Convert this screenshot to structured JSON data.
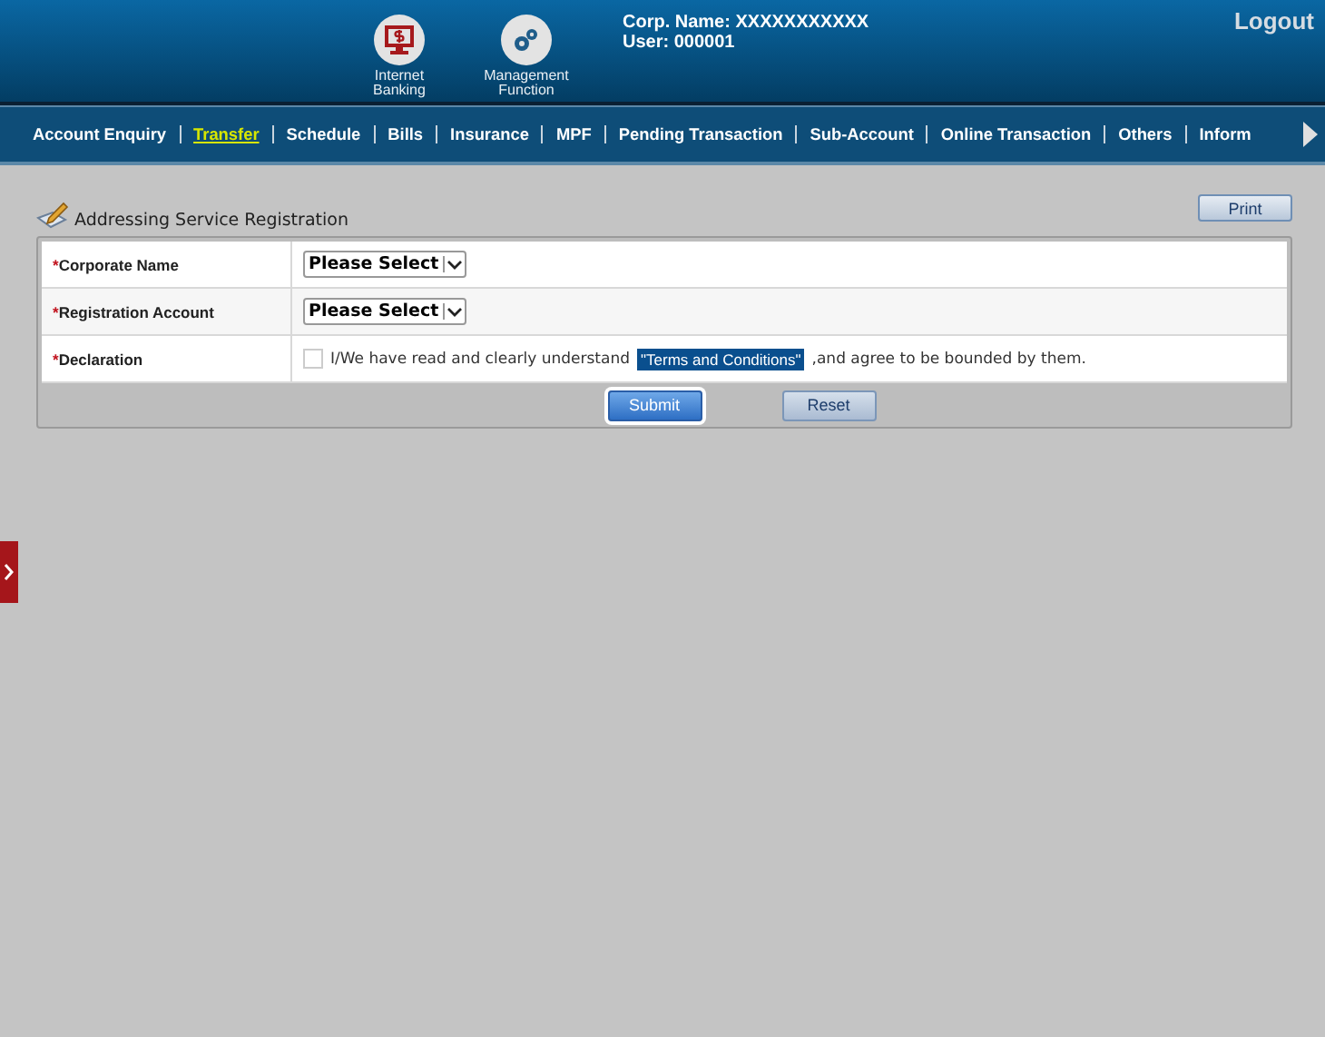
{
  "header": {
    "shortcuts": [
      {
        "kind": "banking",
        "label": "Internet Banking"
      },
      {
        "kind": "management",
        "label": "Management Function"
      }
    ],
    "corp_label": "Corp. Name:",
    "corp_value": "XXXXXXXXXXX",
    "user_label": "User:",
    "user_value": "000001",
    "logout": "Logout"
  },
  "nav": [
    {
      "label": "Account Enquiry",
      "selected": false
    },
    {
      "label": "Transfer",
      "selected": true
    },
    {
      "label": "Schedule",
      "selected": false
    },
    {
      "label": "Bills",
      "selected": false
    },
    {
      "label": "Insurance",
      "selected": false
    },
    {
      "label": "MPF",
      "selected": false
    },
    {
      "label": "Pending Transaction",
      "selected": false
    },
    {
      "label": "Sub-Account",
      "selected": false
    },
    {
      "label": "Online Transaction",
      "selected": false
    },
    {
      "label": "Others",
      "selected": false
    },
    {
      "label": "Inform",
      "selected": false
    }
  ],
  "page": {
    "title": "Addressing Service Registration",
    "print": "Print"
  },
  "form": {
    "rows": [
      {
        "kind": "select",
        "required_mark": "*",
        "label": "Corporate Name",
        "value": "Please Select"
      },
      {
        "kind": "select",
        "required_mark": "*",
        "label": "Registration Account",
        "value": "Please Select"
      },
      {
        "kind": "declaration",
        "required_mark": "*",
        "label": "Declaration",
        "checked": false,
        "before": "I/We have read and clearly understand",
        "link": "\"Terms and Conditions\"",
        "link_selected": true,
        "after": ",and agree to be bounded by them."
      }
    ],
    "buttons": [
      {
        "label": "Submit",
        "primary": true
      },
      {
        "label": "Reset",
        "primary": false
      }
    ]
  }
}
